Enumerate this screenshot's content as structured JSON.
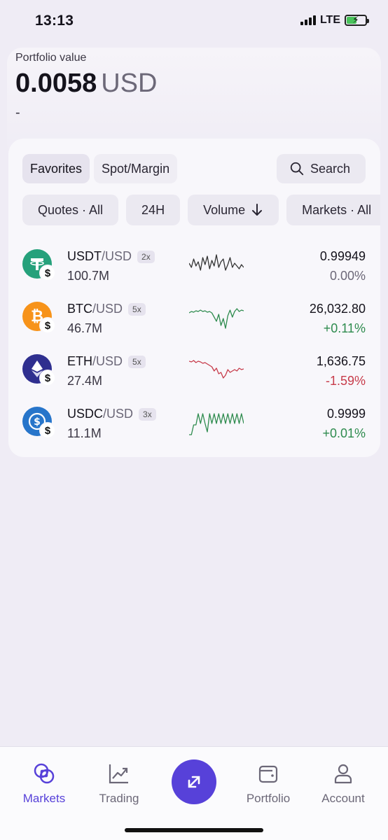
{
  "status": {
    "time": "13:13",
    "network": "LTE"
  },
  "portfolio": {
    "label": "Portfolio value",
    "amount": "0.0058",
    "currency": "USD",
    "change": "-"
  },
  "tabs": [
    {
      "label": "Favorites",
      "active": true
    },
    {
      "label": "Spot/Margin",
      "active": false
    }
  ],
  "search": {
    "label": "Search"
  },
  "filters": [
    {
      "label": "Quotes · All",
      "icon": ""
    },
    {
      "label": "24H",
      "icon": ""
    },
    {
      "label": "Volume",
      "icon": "arrow-down-icon"
    },
    {
      "label": "Markets · All",
      "icon": ""
    }
  ],
  "markets": [
    {
      "base": "USDT",
      "quote": "/USD",
      "leverage": "2x",
      "volume": "100.7M",
      "price": "0.99949",
      "change": "0.00%",
      "trend": "flat",
      "icon_color": "#26a17b",
      "icon": "tether-icon",
      "spark_color": "#333333",
      "spark": [
        20,
        26,
        14,
        24,
        18,
        30,
        12,
        22,
        10,
        28,
        16,
        24,
        8,
        26,
        18,
        14,
        30,
        22,
        12,
        26,
        20,
        24,
        28,
        22,
        26
      ]
    },
    {
      "base": "BTC",
      "quote": "/USD",
      "leverage": "5x",
      "volume": "46.7M",
      "price": "26,032.80",
      "change": "+0.11%",
      "trend": "up",
      "icon_color": "#f7931a",
      "icon": "bitcoin-icon",
      "spark_color": "#2e8b4e",
      "spark": [
        16,
        14,
        15,
        13,
        14,
        12,
        14,
        13,
        15,
        14,
        16,
        22,
        28,
        18,
        34,
        24,
        38,
        20,
        12,
        22,
        14,
        10,
        14,
        12,
        13
      ]
    },
    {
      "base": "ETH",
      "quote": "/USD",
      "leverage": "5x",
      "volume": "27.4M",
      "price": "1,636.75",
      "change": "-1.59%",
      "trend": "down",
      "icon_color": "#2f2f8f",
      "icon": "ethereum-icon",
      "spark_color": "#c73b4a",
      "spark": [
        10,
        11,
        9,
        12,
        10,
        11,
        13,
        12,
        14,
        16,
        18,
        24,
        20,
        28,
        26,
        34,
        30,
        22,
        26,
        24,
        22,
        24,
        20,
        22,
        21
      ]
    },
    {
      "base": "USDC",
      "quote": "/USD",
      "leverage": "3x",
      "volume": "11.1M",
      "price": "0.9999",
      "change": "+0.01%",
      "trend": "up",
      "icon_color": "#2775ca",
      "icon": "usdc-icon",
      "spark_color": "#2e8b4e",
      "spark": [
        40,
        40,
        26,
        26,
        10,
        24,
        10,
        24,
        36,
        10,
        24,
        10,
        24,
        10,
        24,
        10,
        24,
        10,
        24,
        10,
        24,
        10,
        24,
        10,
        24
      ]
    }
  ],
  "nav": [
    {
      "label": "Markets",
      "icon": "markets-icon",
      "active": true
    },
    {
      "label": "Trading",
      "icon": "trending-chart-icon",
      "active": false
    },
    {
      "label": "Portfolio",
      "icon": "wallet-icon",
      "active": false
    },
    {
      "label": "Account",
      "icon": "person-icon",
      "active": false
    }
  ],
  "colors": {
    "accent": "#5741d9",
    "positive": "#2e8b4e",
    "negative": "#c73b4a"
  }
}
